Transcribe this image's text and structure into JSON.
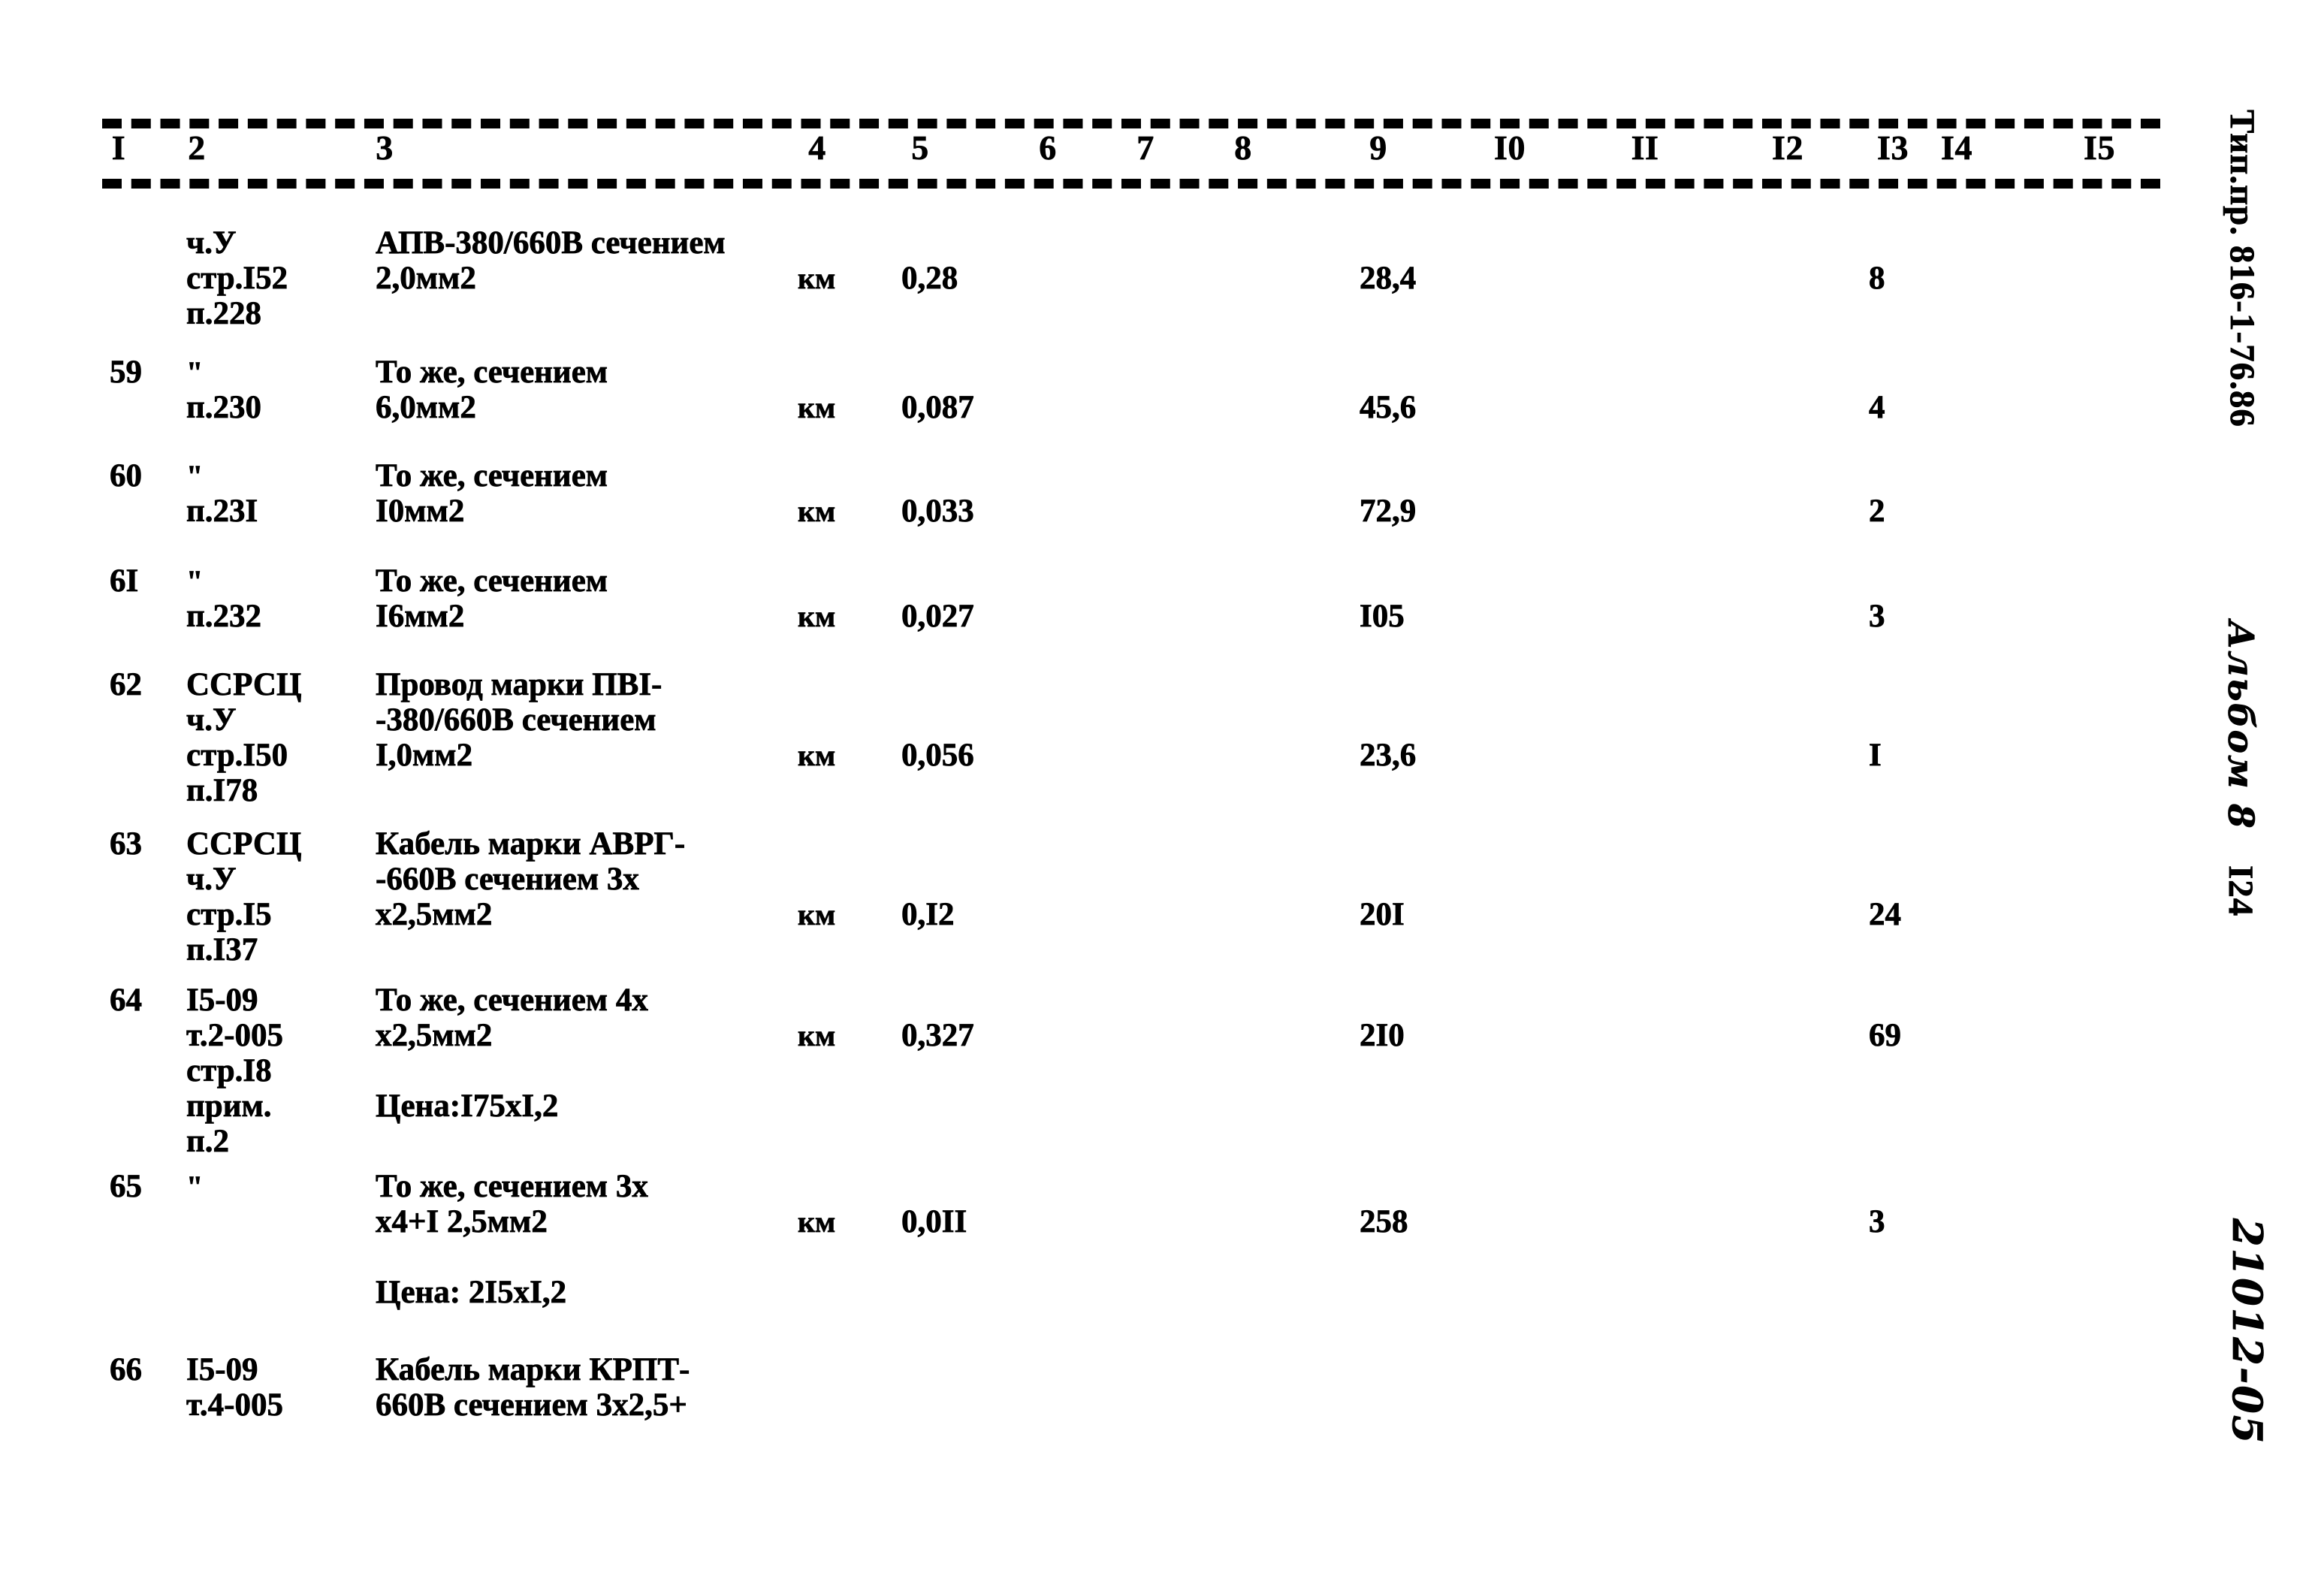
{
  "document": {
    "type": "scanned-cost-estimate-table",
    "language": "ru"
  },
  "table": {
    "column_headers": [
      "I",
      "2",
      "3",
      "4",
      "5",
      "6",
      "7",
      "8",
      "9",
      "I0",
      "II",
      "I2",
      "I3",
      "I4",
      "I5"
    ],
    "rows": [
      {
        "num": "",
        "code_lines": [
          "ч.У",
          "стр.I52",
          "п.228"
        ],
        "desc_lines": [
          "АПВ-380/660В сечением",
          "2,0мм2"
        ],
        "unit": "км",
        "qty": "0,28",
        "price": "28,4",
        "total": "8"
      },
      {
        "num": "59",
        "code_lines": [
          "\"",
          "п.230"
        ],
        "desc_lines": [
          "То же, сечением",
          "6,0мм2"
        ],
        "unit": "км",
        "qty": "0,087",
        "price": "45,6",
        "total": "4"
      },
      {
        "num": "60",
        "code_lines": [
          "\"",
          "п.23I"
        ],
        "desc_lines": [
          "То же, сечением",
          "I0мм2"
        ],
        "unit": "км",
        "qty": "0,033",
        "price": "72,9",
        "total": "2"
      },
      {
        "num": "6I",
        "code_lines": [
          "\"",
          "п.232"
        ],
        "desc_lines": [
          "То же, сечением",
          "I6мм2"
        ],
        "unit": "км",
        "qty": "0,027",
        "price": "I05",
        "total": "3"
      },
      {
        "num": "62",
        "code_lines": [
          "ССРСЦ",
          "ч.У",
          "стр.I50",
          "п.I78"
        ],
        "desc_lines": [
          "Провод марки ПВI-",
          "-380/660В сечением",
          "I,0мм2"
        ],
        "unit": "км",
        "qty": "0,056",
        "price": "23,6",
        "total": "I"
      },
      {
        "num": "63",
        "code_lines": [
          "ССРСЦ",
          "ч.У",
          "стр.I5",
          "п.I37"
        ],
        "desc_lines": [
          "Кабель марки АВРГ-",
          "-660В сечением 3х",
          "х2,5мм2"
        ],
        "unit": "км",
        "qty": "0,I2",
        "price": "20I",
        "total": "24"
      },
      {
        "num": "64",
        "code_lines": [
          "I5-09",
          "т.2-005",
          "стр.I8",
          "прим.",
          "п.2"
        ],
        "desc_lines": [
          "То же, сечением 4х",
          "х2,5мм2",
          "",
          "Цена:I75хI,2"
        ],
        "unit": "км",
        "qty": "0,327",
        "price": "2I0",
        "total": "69"
      },
      {
        "num": "65",
        "code_lines": [
          "\""
        ],
        "desc_lines": [
          "То же, сечением 3х",
          "х4+I 2,5мм2",
          "",
          "Цена: 2I5хI,2"
        ],
        "unit": "км",
        "qty": "0,0II",
        "price": "258",
        "total": "3"
      },
      {
        "num": "66",
        "code_lines": [
          "I5-09",
          "т.4-005"
        ],
        "desc_lines": [
          "Кабель марки КРПТ-",
          "660В сечением 3х2,5+"
        ],
        "unit": "",
        "qty": "",
        "price": "",
        "total": ""
      }
    ]
  },
  "margin_notes": {
    "type_project": "Тип.пр. 816-1-76.86",
    "album": "Альбом 8",
    "page_number": "I24",
    "drawing_code": "21012-05"
  }
}
